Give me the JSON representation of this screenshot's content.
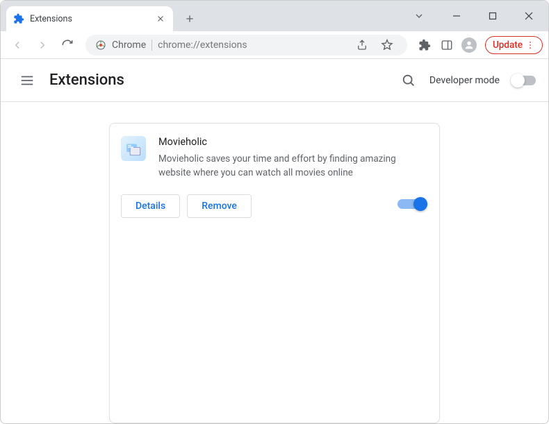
{
  "tab": {
    "title": "Extensions"
  },
  "omnibox": {
    "chip": "Chrome",
    "url": "chrome://extensions"
  },
  "toolbar": {
    "update_label": "Update"
  },
  "header": {
    "title": "Extensions",
    "dev_mode_label": "Developer mode"
  },
  "extension": {
    "name": "Movieholic",
    "description": "Movieholic saves your time and effort by finding amazing website where you can watch all movies online",
    "details_label": "Details",
    "remove_label": "Remove",
    "enabled": true
  }
}
